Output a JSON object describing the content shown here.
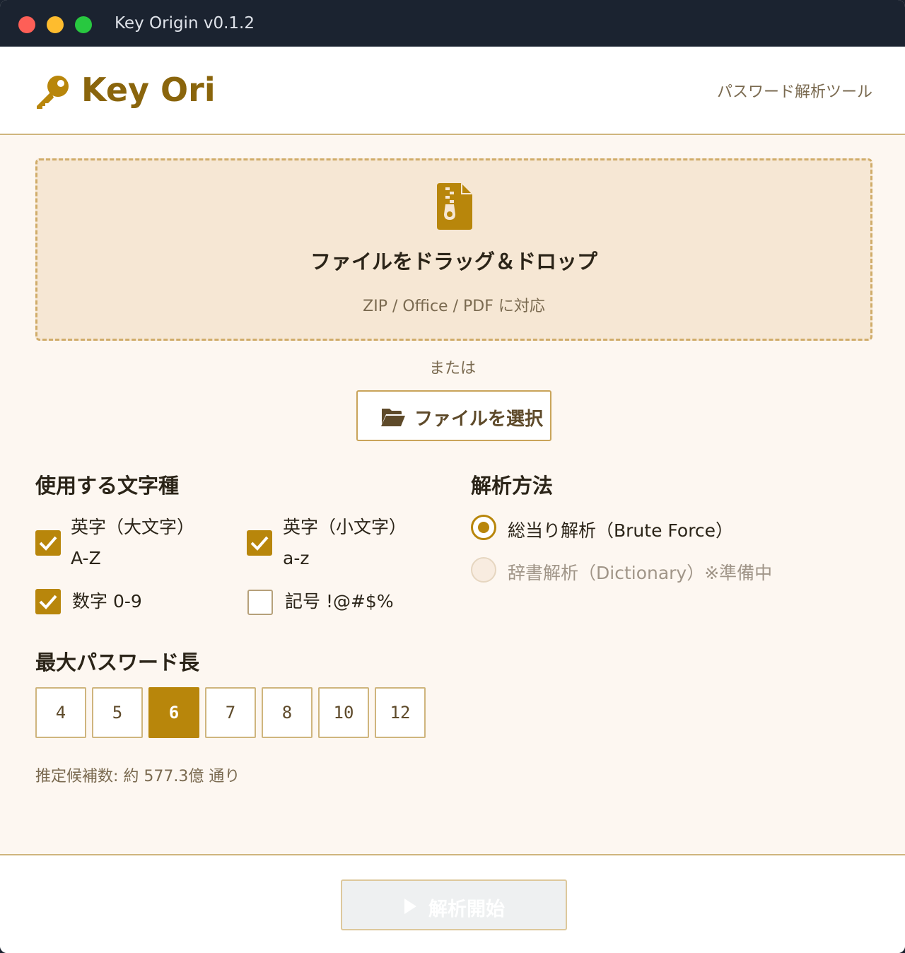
{
  "window": {
    "title": "Key Origin v0.1.2"
  },
  "header": {
    "logo_text": "Key Ori",
    "subtitle": "パスワード解析ツール"
  },
  "dropzone": {
    "title": "ファイルをドラッグ＆ドロップ",
    "subtitle": "ZIP / Office / PDF に対応",
    "icon": "zip-file-icon"
  },
  "or_text": "または",
  "select_button": {
    "label": "ファイルを選択",
    "icon": "folder-open-icon"
  },
  "charset": {
    "title": "使用する文字種",
    "options": [
      {
        "label_line1": "英字（大文字）",
        "label_line2": "A-Z",
        "checked": true
      },
      {
        "label_line1": "英字（小文字）",
        "label_line2": "a-z",
        "checked": true
      },
      {
        "label_line1": "数字 0-9",
        "label_line2": "",
        "checked": true
      },
      {
        "label_line1": "記号 !@#$%",
        "label_line2": "",
        "checked": false
      }
    ]
  },
  "method": {
    "title": "解析方法",
    "options": [
      {
        "label": "総当り解析（Brute Force）",
        "selected": true,
        "disabled": false
      },
      {
        "label": "辞書解析（Dictionary）※準備中",
        "selected": false,
        "disabled": true
      }
    ]
  },
  "max_length": {
    "title": "最大パスワード長",
    "options": [
      "4",
      "5",
      "6",
      "7",
      "8",
      "10",
      "12"
    ],
    "selected": "6"
  },
  "estimate": "推定候補数: 約 577.3億 通り",
  "start_button": {
    "label": "解析開始",
    "enabled": false,
    "icon": "play-icon"
  },
  "colors": {
    "accent": "#b8860b",
    "brand_text": "#8a650c",
    "background": "#fdf7f1",
    "dropzone_bg": "#f6e7d4"
  }
}
